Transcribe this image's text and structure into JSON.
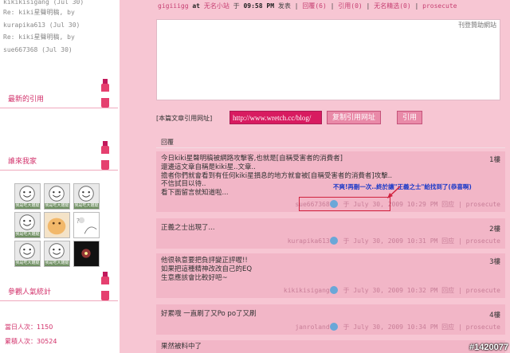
{
  "sidebar": {
    "recent_lines": [
      "kikikisigang (Jul 30)",
      "Re: kiki星聲明稿, by",
      "kurapika613 (Jul 30)",
      "Re: kiki星聲明稿, by",
      "sue667368 (Jul 30)"
    ],
    "sections": {
      "latest_trackbacks": "最新的引用",
      "followers": "誰來我家",
      "visitor_stats": "參觀人氣統計"
    },
    "avatar_label": "我是吃大雞腿",
    "stats": {
      "today": "當日人次：1150",
      "total": "累積人次：30524"
    }
  },
  "post": {
    "author": "gigiiigg",
    "at": "at",
    "site": "无名小站",
    "on": "于",
    "time": "09:58 PM",
    "published": "发表",
    "sep": "|",
    "reply_link": "回覆(6)",
    "quote_link": "引用(0)",
    "featured_link": "无名精选(0)",
    "prosecute_link": "prosecute",
    "sponsor_link": "刊登贊助網站"
  },
  "trackback": {
    "label": "[本篇文章引用网址]",
    "url": "http://www.wretch.cc/blog/",
    "copy_button": "复制引用网址",
    "quote_button": "引用"
  },
  "replies_heading": "回覆",
  "comments": [
    {
      "lines": [
        "今日kiki星聲明稿被網路攻擊客,也就是[自稱受害者的消費者]",
        "還邊這文章自稱是kiki星..文章..",
        "擔者你們就會看到有任何kiki星損息的地方就會被[自稱受害者的消費者]攻擊..",
        "不信試目以待..",
        "看下面留言就知道啦..."
      ],
      "floor": "1樓",
      "author": "sue667368",
      "on": "于",
      "time": "July 30, 2009 10:29 PM",
      "reply_label": "回应",
      "sep": "|",
      "prosecute": "prosecute"
    },
    {
      "lines": [
        "正義之士出現了..."
      ],
      "floor": "2樓",
      "author": "kurapika613",
      "on": "于",
      "time": "July 30, 2009 10:31 PM",
      "reply_label": "回应",
      "sep": "|",
      "prosecute": "prosecute"
    },
    {
      "lines": [
        "他很執意要把負評變正評喔!!",
        "如果把這種精神改改自己的EQ",
        "生意應該會比較好吧~"
      ],
      "floor": "3樓",
      "author": "kikikisigang",
      "on": "于",
      "time": "July 30, 2009 10:32 PM",
      "reply_label": "回应",
      "sep": "|",
      "prosecute": "prosecute"
    },
    {
      "lines": [
        "好累哦  一直刷了又Po po了又刷"
      ],
      "floor": "4樓",
      "author": "janroland",
      "on": "于",
      "time": "July 30, 2009 10:34 PM",
      "reply_label": "回应",
      "sep": "|",
      "prosecute": "prosecute"
    },
    {
      "lines": [
        "果然被料中了"
      ],
      "floor": "",
      "author": "",
      "on": "",
      "time": "",
      "reply_label": "",
      "sep": "",
      "prosecute": ""
    }
  ],
  "annotation": "不爽!再刪一次..終於讓\"正義之士\"給找到了(恭喜啊)",
  "watermark": "#1420077",
  "colors": {
    "page_bg": "#f7c6d3",
    "comment_bg": "#f2b6c7",
    "accent": "#d2306a",
    "annotation": "#1b39c8",
    "highlight_box": "#d1233f"
  }
}
